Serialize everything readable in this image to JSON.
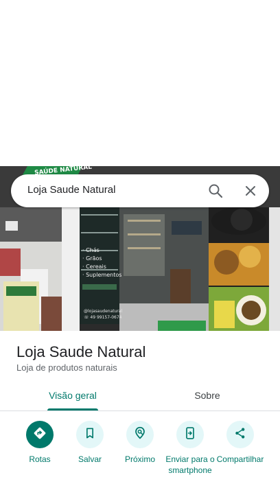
{
  "search": {
    "query": "Loja Saude Natural"
  },
  "photo": {
    "signage": "SAÚDE NATURAL",
    "window_list": [
      "· Chás",
      "· Grãos",
      "· Cereais",
      "· Suplementos"
    ],
    "contact_lines": [
      "@lojasaudenatural",
      "☏ 49 99157-0674"
    ]
  },
  "place": {
    "name": "Loja Saude Natural",
    "category": "Loja de produtos naturais"
  },
  "tabs": [
    {
      "label": "Visão geral",
      "selected": true
    },
    {
      "label": "Sobre",
      "selected": false
    }
  ],
  "actions": [
    {
      "label": "Rotas",
      "icon": "directions-icon"
    },
    {
      "label": "Salvar",
      "icon": "bookmark-icon"
    },
    {
      "label": "Próximo",
      "icon": "nearby-icon"
    },
    {
      "label": "Enviar para o smartphone",
      "icon": "send-to-phone-icon"
    },
    {
      "label": "Compartilhar",
      "icon": "share-icon"
    }
  ],
  "colors": {
    "accent": "#00796b",
    "action_bg": "#e3f7f8"
  }
}
